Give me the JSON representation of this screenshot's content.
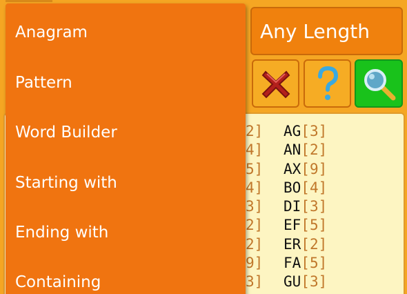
{
  "length_select": {
    "value": "Any Length"
  },
  "tools": {
    "clear_icon": "red-x-icon",
    "help_icon": "question-mark-icon",
    "search_icon": "magnifier-icon"
  },
  "dropdown": {
    "items": [
      {
        "label": "Anagram"
      },
      {
        "label": "Pattern"
      },
      {
        "label": "Word Builder"
      },
      {
        "label": "Starting with"
      },
      {
        "label": "Ending with"
      },
      {
        "label": "Containing"
      }
    ]
  },
  "results": {
    "rows": [
      {
        "prev_count": "2]",
        "word": "AG",
        "count": "3"
      },
      {
        "prev_count": "4]",
        "word": "AN",
        "count": "2"
      },
      {
        "prev_count": "5]",
        "word": "AX",
        "count": "9"
      },
      {
        "prev_count": "4]",
        "word": "BO",
        "count": "4"
      },
      {
        "prev_count": "3]",
        "word": "DI",
        "count": "3"
      },
      {
        "prev_count": "2]",
        "word": "EF",
        "count": "5"
      },
      {
        "prev_count": "2]",
        "word": "ER",
        "count": "2"
      },
      {
        "prev_count": "9]",
        "word": "FA",
        "count": "5"
      },
      {
        "prev_count": "3]",
        "word": "GU",
        "count": "3"
      }
    ]
  }
}
